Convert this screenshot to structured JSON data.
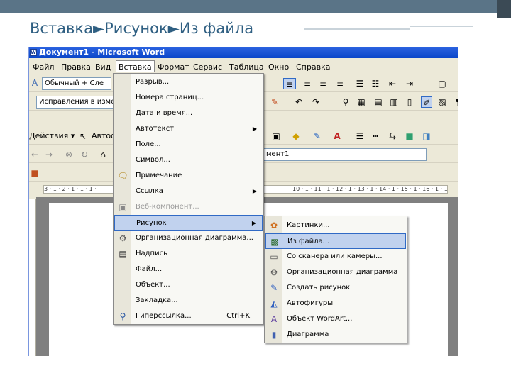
{
  "slide": {
    "title": "Вставка►Рисунок►Из файла"
  },
  "window": {
    "title": "Документ1 - Microsoft Word"
  },
  "menubar": [
    "Файл",
    "Правка",
    "Вид",
    "Вставка",
    "Формат",
    "Сервис",
    "Таблица",
    "Окно",
    "Справка"
  ],
  "toolbar": {
    "style_combo": "Обычный + Сле",
    "track_combo": "Исправления в измене",
    "actions_label": "Действия ▾",
    "autoshapes_label": "Автоф",
    "address_text": "мент1"
  },
  "ruler": {
    "left_text": "3 · 1 · 2 · 1 · 1 · 1 ·",
    "right_text": "10 · 1 · 11 · 1 · 12 · 1 · 13 · 1 · 14 · 1 · 15 · 1 · 16 · 1 · 17 · 1 ·"
  },
  "insert_menu": {
    "items": [
      {
        "label": "Разрыв...",
        "icon": "",
        "disabled": false,
        "submenu": false,
        "shortcut": ""
      },
      {
        "label": "Номера страниц...",
        "icon": "",
        "disabled": false,
        "submenu": false,
        "shortcut": ""
      },
      {
        "label": "Дата и время...",
        "icon": "",
        "disabled": false,
        "submenu": false,
        "shortcut": ""
      },
      {
        "label": "Автотекст",
        "icon": "",
        "disabled": false,
        "submenu": true,
        "shortcut": ""
      },
      {
        "label": "Поле...",
        "icon": "",
        "disabled": false,
        "submenu": false,
        "shortcut": ""
      },
      {
        "label": "Символ...",
        "icon": "",
        "disabled": false,
        "submenu": false,
        "shortcut": ""
      },
      {
        "label": "Примечание",
        "icon": "comment-icon",
        "disabled": false,
        "submenu": false,
        "shortcut": ""
      },
      {
        "label": "Ссылка",
        "icon": "",
        "disabled": false,
        "submenu": true,
        "shortcut": ""
      },
      {
        "label": "Веб-компонент...",
        "icon": "web-component-icon",
        "disabled": true,
        "submenu": false,
        "shortcut": ""
      },
      {
        "label": "Рисунок",
        "icon": "",
        "disabled": false,
        "submenu": true,
        "shortcut": "",
        "highlighted": true
      },
      {
        "label": "Организационная диаграмма...",
        "icon": "org-chart-icon",
        "disabled": false,
        "submenu": false,
        "shortcut": ""
      },
      {
        "label": "Надпись",
        "icon": "textbox-icon",
        "disabled": false,
        "submenu": false,
        "shortcut": ""
      },
      {
        "label": "Файл...",
        "icon": "",
        "disabled": false,
        "submenu": false,
        "shortcut": ""
      },
      {
        "label": "Объект...",
        "icon": "",
        "disabled": false,
        "submenu": false,
        "shortcut": ""
      },
      {
        "label": "Закладка...",
        "icon": "",
        "disabled": false,
        "submenu": false,
        "shortcut": ""
      },
      {
        "label": "Гиперссылка...",
        "icon": "hyperlink-icon",
        "disabled": false,
        "submenu": false,
        "shortcut": "Ctrl+K"
      }
    ]
  },
  "picture_submenu": {
    "items": [
      {
        "label": "Картинки...",
        "icon": "clipart-icon",
        "highlighted": false
      },
      {
        "label": "Из файла...",
        "icon": "picture-from-file-icon",
        "highlighted": true
      },
      {
        "label": "Со сканера или камеры...",
        "icon": "scanner-icon",
        "highlighted": false
      },
      {
        "label": "Организационная диаграмма",
        "icon": "org-chart-icon",
        "highlighted": false
      },
      {
        "label": "Создать рисунок",
        "icon": "new-drawing-icon",
        "highlighted": false
      },
      {
        "label": "Автофигуры",
        "icon": "autoshapes-icon",
        "highlighted": false
      },
      {
        "label": "Объект WordArt...",
        "icon": "wordart-icon",
        "highlighted": false
      },
      {
        "label": "Диаграмма",
        "icon": "chart-icon",
        "highlighted": false
      }
    ]
  },
  "colors": {
    "title_text": "#2f5f82",
    "titlebar": "#0a46c9",
    "highlight": "#c1d2ee"
  }
}
